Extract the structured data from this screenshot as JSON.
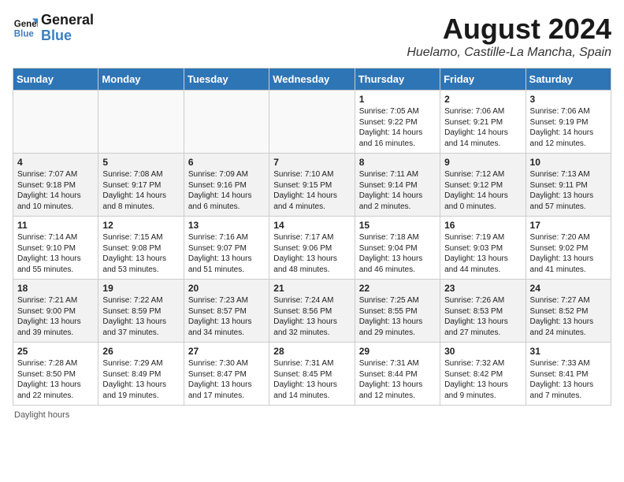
{
  "header": {
    "logo_line1": "General",
    "logo_line2": "Blue",
    "month_year": "August 2024",
    "location": "Huelamo, Castille-La Mancha, Spain"
  },
  "columns": [
    "Sunday",
    "Monday",
    "Tuesday",
    "Wednesday",
    "Thursday",
    "Friday",
    "Saturday"
  ],
  "weeks": [
    [
      {
        "day": "",
        "info": ""
      },
      {
        "day": "",
        "info": ""
      },
      {
        "day": "",
        "info": ""
      },
      {
        "day": "",
        "info": ""
      },
      {
        "day": "1",
        "info": "Sunrise: 7:05 AM\nSunset: 9:22 PM\nDaylight: 14 hours and 16 minutes."
      },
      {
        "day": "2",
        "info": "Sunrise: 7:06 AM\nSunset: 9:21 PM\nDaylight: 14 hours and 14 minutes."
      },
      {
        "day": "3",
        "info": "Sunrise: 7:06 AM\nSunset: 9:19 PM\nDaylight: 14 hours and 12 minutes."
      }
    ],
    [
      {
        "day": "4",
        "info": "Sunrise: 7:07 AM\nSunset: 9:18 PM\nDaylight: 14 hours and 10 minutes."
      },
      {
        "day": "5",
        "info": "Sunrise: 7:08 AM\nSunset: 9:17 PM\nDaylight: 14 hours and 8 minutes."
      },
      {
        "day": "6",
        "info": "Sunrise: 7:09 AM\nSunset: 9:16 PM\nDaylight: 14 hours and 6 minutes."
      },
      {
        "day": "7",
        "info": "Sunrise: 7:10 AM\nSunset: 9:15 PM\nDaylight: 14 hours and 4 minutes."
      },
      {
        "day": "8",
        "info": "Sunrise: 7:11 AM\nSunset: 9:14 PM\nDaylight: 14 hours and 2 minutes."
      },
      {
        "day": "9",
        "info": "Sunrise: 7:12 AM\nSunset: 9:12 PM\nDaylight: 14 hours and 0 minutes."
      },
      {
        "day": "10",
        "info": "Sunrise: 7:13 AM\nSunset: 9:11 PM\nDaylight: 13 hours and 57 minutes."
      }
    ],
    [
      {
        "day": "11",
        "info": "Sunrise: 7:14 AM\nSunset: 9:10 PM\nDaylight: 13 hours and 55 minutes."
      },
      {
        "day": "12",
        "info": "Sunrise: 7:15 AM\nSunset: 9:08 PM\nDaylight: 13 hours and 53 minutes."
      },
      {
        "day": "13",
        "info": "Sunrise: 7:16 AM\nSunset: 9:07 PM\nDaylight: 13 hours and 51 minutes."
      },
      {
        "day": "14",
        "info": "Sunrise: 7:17 AM\nSunset: 9:06 PM\nDaylight: 13 hours and 48 minutes."
      },
      {
        "day": "15",
        "info": "Sunrise: 7:18 AM\nSunset: 9:04 PM\nDaylight: 13 hours and 46 minutes."
      },
      {
        "day": "16",
        "info": "Sunrise: 7:19 AM\nSunset: 9:03 PM\nDaylight: 13 hours and 44 minutes."
      },
      {
        "day": "17",
        "info": "Sunrise: 7:20 AM\nSunset: 9:02 PM\nDaylight: 13 hours and 41 minutes."
      }
    ],
    [
      {
        "day": "18",
        "info": "Sunrise: 7:21 AM\nSunset: 9:00 PM\nDaylight: 13 hours and 39 minutes."
      },
      {
        "day": "19",
        "info": "Sunrise: 7:22 AM\nSunset: 8:59 PM\nDaylight: 13 hours and 37 minutes."
      },
      {
        "day": "20",
        "info": "Sunrise: 7:23 AM\nSunset: 8:57 PM\nDaylight: 13 hours and 34 minutes."
      },
      {
        "day": "21",
        "info": "Sunrise: 7:24 AM\nSunset: 8:56 PM\nDaylight: 13 hours and 32 minutes."
      },
      {
        "day": "22",
        "info": "Sunrise: 7:25 AM\nSunset: 8:55 PM\nDaylight: 13 hours and 29 minutes."
      },
      {
        "day": "23",
        "info": "Sunrise: 7:26 AM\nSunset: 8:53 PM\nDaylight: 13 hours and 27 minutes."
      },
      {
        "day": "24",
        "info": "Sunrise: 7:27 AM\nSunset: 8:52 PM\nDaylight: 13 hours and 24 minutes."
      }
    ],
    [
      {
        "day": "25",
        "info": "Sunrise: 7:28 AM\nSunset: 8:50 PM\nDaylight: 13 hours and 22 minutes."
      },
      {
        "day": "26",
        "info": "Sunrise: 7:29 AM\nSunset: 8:49 PM\nDaylight: 13 hours and 19 minutes."
      },
      {
        "day": "27",
        "info": "Sunrise: 7:30 AM\nSunset: 8:47 PM\nDaylight: 13 hours and 17 minutes."
      },
      {
        "day": "28",
        "info": "Sunrise: 7:31 AM\nSunset: 8:45 PM\nDaylight: 13 hours and 14 minutes."
      },
      {
        "day": "29",
        "info": "Sunrise: 7:31 AM\nSunset: 8:44 PM\nDaylight: 13 hours and 12 minutes."
      },
      {
        "day": "30",
        "info": "Sunrise: 7:32 AM\nSunset: 8:42 PM\nDaylight: 13 hours and 9 minutes."
      },
      {
        "day": "31",
        "info": "Sunrise: 7:33 AM\nSunset: 8:41 PM\nDaylight: 13 hours and 7 minutes."
      }
    ]
  ],
  "footer": "Daylight hours"
}
